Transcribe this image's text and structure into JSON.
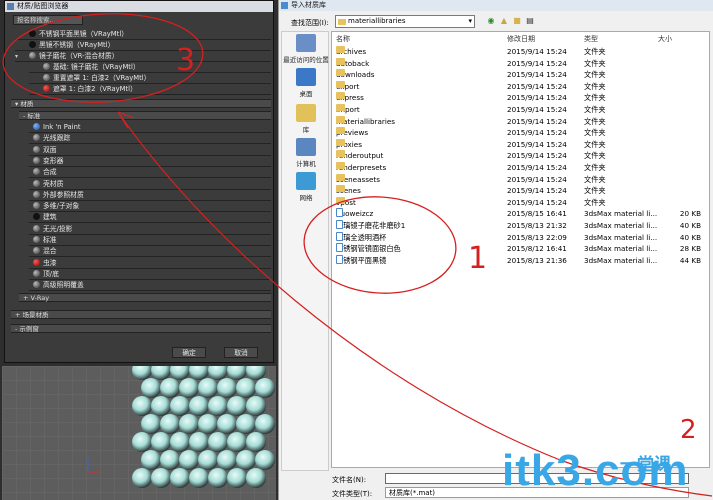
{
  "left_panel": {
    "title": "材质/贴图浏览器",
    "search_placeholder": "按名称搜索...",
    "scene_rows": [
      {
        "label": "不锈钢平面黑镜（VRayMtl）",
        "swatch": "black"
      },
      {
        "label": "黑镜不锈钢（VRayMtl）",
        "swatch": "black"
      },
      {
        "label": "镜子磨花（VR-混合材质）",
        "swatch": "grey"
      },
      {
        "label": "基础: 镜子磨花（VRayMtl）",
        "swatch": "grey"
      },
      {
        "label": "重置遮罩 1: 白漆2（VRayMtl）",
        "swatch": "grey"
      },
      {
        "label": "遮罩 1: 白漆2（VRayMtl）",
        "swatch": "red"
      }
    ],
    "materials_header": "材质",
    "standard_header": "标准",
    "material_types": [
      {
        "label": "Ink 'n Paint",
        "swatch": "blue"
      },
      {
        "label": "光线跟踪",
        "swatch": "grey"
      },
      {
        "label": "双面",
        "swatch": "grey"
      },
      {
        "label": "变形器",
        "swatch": "grey"
      },
      {
        "label": "合成",
        "swatch": "grey"
      },
      {
        "label": "壳材质",
        "swatch": "grey"
      },
      {
        "label": "外部参照材质",
        "swatch": "grey"
      },
      {
        "label": "多维/子对象",
        "swatch": "grey"
      },
      {
        "label": "建筑",
        "swatch": "black"
      },
      {
        "label": "无光/投影",
        "swatch": "grey"
      },
      {
        "label": "标准",
        "swatch": "grey"
      },
      {
        "label": "混合",
        "swatch": "grey"
      },
      {
        "label": "虫漆",
        "swatch": "red"
      },
      {
        "label": "顶/底",
        "swatch": "grey"
      },
      {
        "label": "高级照明覆盖",
        "swatch": "grey"
      }
    ],
    "vray_header": "+ V-Ray",
    "scene_materials_header": "+ 场景材质",
    "sample_slots_header": "- 示例窗",
    "ok_label": "确定",
    "cancel_label": "取消"
  },
  "dialog": {
    "title": "导入材质库",
    "look_in_label": "查找范围(I):",
    "look_in_value": "materiallibraries",
    "places": [
      {
        "label": "最近访问的位置",
        "icon": "recent-icon"
      },
      {
        "label": "桌面",
        "icon": "desktop-icon"
      },
      {
        "label": "库",
        "icon": "library-icon"
      },
      {
        "label": "计算机",
        "icon": "computer-icon"
      },
      {
        "label": "网络",
        "icon": "network-icon"
      }
    ],
    "columns": {
      "name": "名称",
      "date": "修改日期",
      "type": "类型",
      "size": "大小"
    },
    "folders": [
      {
        "name": "archives",
        "date": "2015/9/14 15:24",
        "type": "文件夹",
        "size": ""
      },
      {
        "name": "autoback",
        "date": "2015/9/14 15:24",
        "type": "文件夹",
        "size": ""
      },
      {
        "name": "downloads",
        "date": "2015/9/14 15:24",
        "type": "文件夹",
        "size": ""
      },
      {
        "name": "export",
        "date": "2015/9/14 15:24",
        "type": "文件夹",
        "size": ""
      },
      {
        "name": "express",
        "date": "2015/9/14 15:24",
        "type": "文件夹",
        "size": ""
      },
      {
        "name": "import",
        "date": "2015/9/14 15:24",
        "type": "文件夹",
        "size": ""
      },
      {
        "name": "materiallibraries",
        "date": "2015/9/14 15:24",
        "type": "文件夹",
        "size": ""
      },
      {
        "name": "previews",
        "date": "2015/9/14 15:24",
        "type": "文件夹",
        "size": ""
      },
      {
        "name": "proxies",
        "date": "2015/9/14 15:24",
        "type": "文件夹",
        "size": ""
      },
      {
        "name": "renderoutput",
        "date": "2015/9/14 15:24",
        "type": "文件夹",
        "size": ""
      },
      {
        "name": "renderpresets",
        "date": "2015/9/14 15:24",
        "type": "文件夹",
        "size": ""
      },
      {
        "name": "sceneassets",
        "date": "2015/9/14 15:24",
        "type": "文件夹",
        "size": ""
      },
      {
        "name": "scenes",
        "date": "2015/9/14 15:24",
        "type": "文件夹",
        "size": ""
      },
      {
        "name": "vpost",
        "date": "2015/9/14 15:24",
        "type": "文件夹",
        "size": ""
      }
    ],
    "files": [
      {
        "name": "duoweizcz",
        "date": "2015/8/15 16:41",
        "type": "3dsMax material li...",
        "size": "20 KB"
      },
      {
        "name": "玻璃镜子磨花非磨砂1",
        "date": "2015/8/13 21:32",
        "type": "3dsMax material li...",
        "size": "40 KB"
      },
      {
        "name": "玻璃全透明酒杯",
        "date": "2015/8/13 22:09",
        "type": "3dsMax material li...",
        "size": "40 KB"
      },
      {
        "name": "不锈钢管镜面银白色",
        "date": "2015/8/12 16:41",
        "type": "3dsMax material li...",
        "size": "28 KB"
      },
      {
        "name": "不锈钢平面黑镜",
        "date": "2015/8/13 21:36",
        "type": "3dsMax material li...",
        "size": "44 KB"
      }
    ],
    "filename_label": "文件名(N):",
    "filename_value": "",
    "filetype_label": "文件类型(T):",
    "filetype_value": "材质库(*.mat)"
  },
  "annotations": {
    "num1": "1",
    "num2": "2",
    "num3": "3"
  },
  "watermark": {
    "text": "itk3.com",
    "sub": "一堂课"
  },
  "colors": {
    "annotation": "#d42020",
    "watermark": "#39a6e6",
    "folder": "#e8c25c"
  }
}
